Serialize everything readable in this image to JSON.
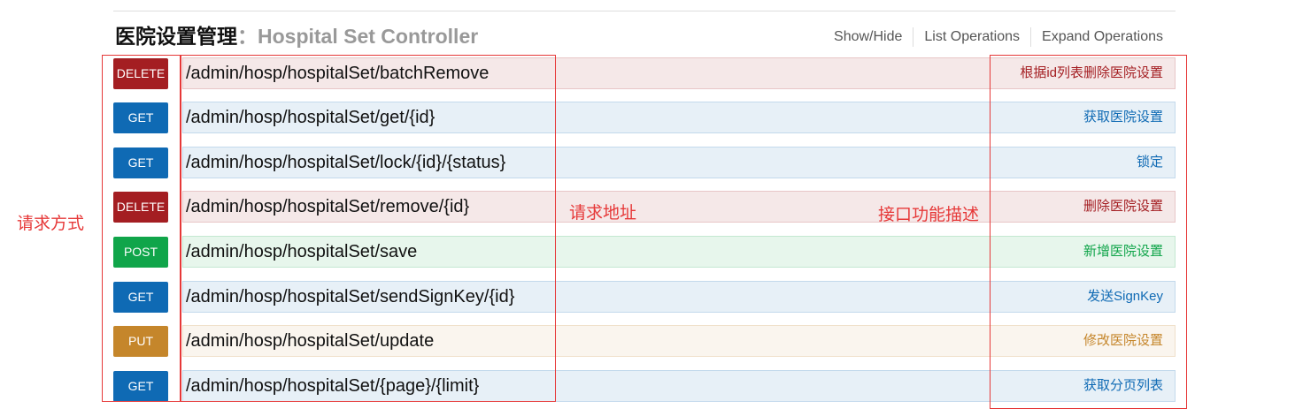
{
  "header": {
    "title_cn": "医院设置管理",
    "separator": "：",
    "title_en": "Hospital Set Controller",
    "operations": [
      "Show/Hide",
      "List Operations",
      "Expand Operations"
    ]
  },
  "endpoints": [
    {
      "method": "DELETE",
      "path": "/admin/hosp/hospitalSet/batchRemove",
      "description": "根据id列表删除医院设置"
    },
    {
      "method": "GET",
      "path": "/admin/hosp/hospitalSet/get/{id}",
      "description": "获取医院设置"
    },
    {
      "method": "GET",
      "path": "/admin/hosp/hospitalSet/lock/{id}/{status}",
      "description": "锁定"
    },
    {
      "method": "DELETE",
      "path": "/admin/hosp/hospitalSet/remove/{id}",
      "description": "删除医院设置"
    },
    {
      "method": "POST",
      "path": "/admin/hosp/hospitalSet/save",
      "description": "新增医院设置"
    },
    {
      "method": "GET",
      "path": "/admin/hosp/hospitalSet/sendSignKey/{id}",
      "description": "发送SignKey"
    },
    {
      "method": "PUT",
      "path": "/admin/hosp/hospitalSet/update",
      "description": "修改医院设置"
    },
    {
      "method": "GET",
      "path": "/admin/hosp/hospitalSet/{page}/{limit}",
      "description": "获取分页列表"
    }
  ],
  "annotations": {
    "method_label": "请求方式",
    "path_label": "请求地址",
    "description_label": "接口功能描述"
  },
  "colors": {
    "delete": "#a41e22",
    "get": "#0f6ab4",
    "post": "#10a54a",
    "put": "#c5862b",
    "annotation": "#e63838"
  }
}
